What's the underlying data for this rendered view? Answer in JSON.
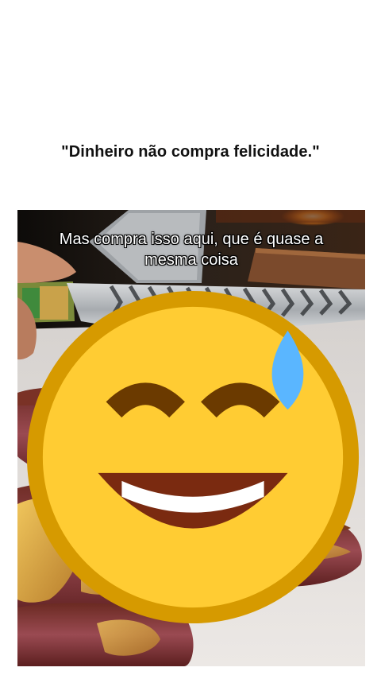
{
  "post": {
    "headline": "\"Dinheiro não compra felicidade.\""
  },
  "video": {
    "caption_line1": "Mas compra isso aqui, que é quase a",
    "caption_line2": "mesma coisa",
    "caption_emoji": "sweat-smile-emoji"
  },
  "colors": {
    "background": "#ffffff",
    "text": "#111111",
    "cutting_board": "#e9e4e0",
    "meat_dark": "#5a1e1e",
    "meat_pink": "#9b4a55",
    "fat_golden": "#d8a548"
  }
}
